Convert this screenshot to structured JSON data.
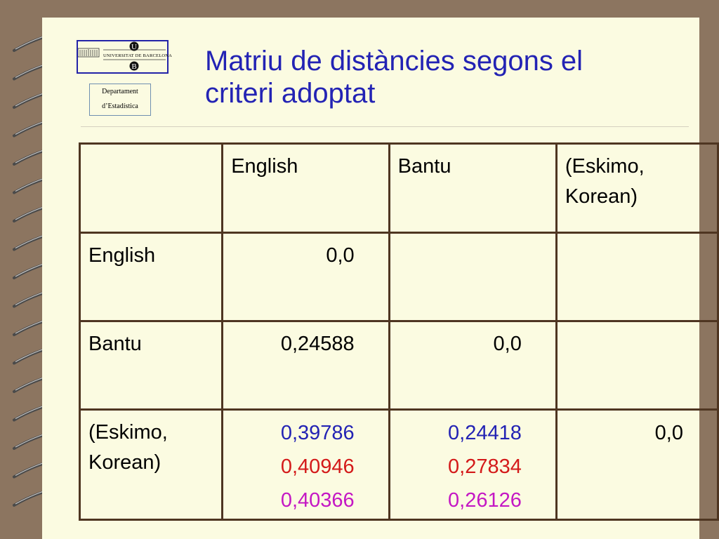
{
  "logo": {
    "letter_top": "U",
    "letter_bottom": "B",
    "name": "UNIVERSITAT DE BARCELONA"
  },
  "department": {
    "line1": "Departament",
    "line2": "d’Estadística"
  },
  "title": {
    "line1": "Matriu de distàncies segons el",
    "line2": "criteri adoptat"
  },
  "table": {
    "column_headers": [
      "",
      "English",
      "Bantu",
      "(Eskimo,\nKorean)"
    ],
    "rows": [
      {
        "label": "English",
        "cells": [
          [
            "0,0"
          ],
          [],
          []
        ]
      },
      {
        "label": "Bantu",
        "cells": [
          [
            "0,24588"
          ],
          [
            "0,0"
          ],
          []
        ]
      },
      {
        "label": "(Eskimo,\nKorean)",
        "cells": [
          [
            "0,39786",
            "0,40946",
            "0,40366"
          ],
          [
            "0,24418",
            "0,27834",
            "0,26126"
          ],
          [
            "0,0"
          ]
        ]
      }
    ]
  },
  "colors": {
    "title": "#2323b4",
    "value_1": "#2323b4",
    "value_2": "#d41a1a",
    "value_3": "#c417c4",
    "border": "#4e3521",
    "paper": "#fbfbe1",
    "background": "#8c7560"
  }
}
